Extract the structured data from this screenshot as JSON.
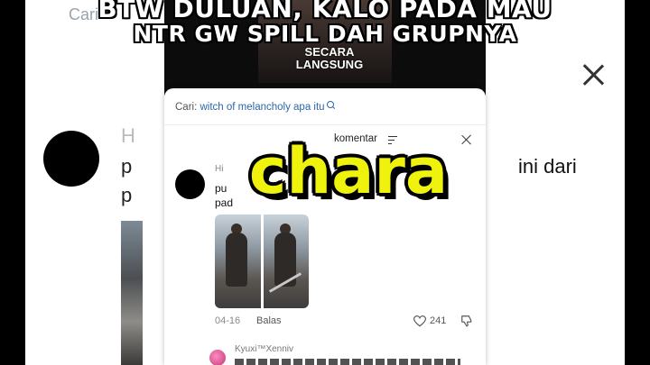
{
  "overlay": {
    "top_caption_line1": "BTW DULUAN, KALO PADA MAU",
    "top_caption_line2": "NTR GW SPILL DAH GRUPNYA",
    "keyword": "chara"
  },
  "video": {
    "caption_line1": "SECARA",
    "caption_line2": "LANGSUNG"
  },
  "background": {
    "search_fragment": "Cari",
    "name_fragment": "H",
    "text_fragment_1": "p",
    "text_fragment_2": "p",
    "right_text": "ini dari"
  },
  "sheet": {
    "search_label": "Cari:",
    "search_query": "witch of melancholy apa itu",
    "title": "komentar",
    "comment": {
      "user": "Hi",
      "line1": "pu",
      "line2": "pad",
      "date": "04-16",
      "reply_label": "Balas",
      "likes": "241"
    },
    "reply": {
      "user": "Kyuxi™Xenniv"
    }
  },
  "colors": {
    "keyword_yellow": "#eef20c",
    "link_blue": "#2c66a8"
  }
}
